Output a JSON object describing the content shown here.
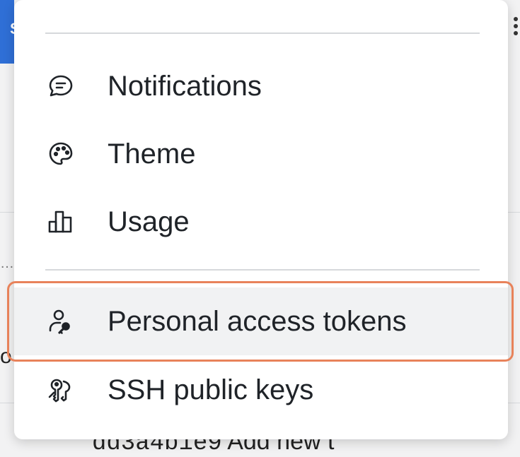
{
  "background": {
    "left_letter": "S",
    "ellipsis": "…",
    "partial_letter": "o",
    "bottom_code": "dd3a4b1e9",
    "bottom_text": "Add new t"
  },
  "menu": {
    "items": [
      {
        "label": "Notifications",
        "icon": "notification-bubble-icon",
        "active": false
      },
      {
        "label": "Theme",
        "icon": "palette-icon",
        "active": false
      },
      {
        "label": "Usage",
        "icon": "usage-chart-icon",
        "active": false
      },
      {
        "label": "Personal access tokens",
        "icon": "user-key-icon",
        "active": true
      },
      {
        "label": "SSH public keys",
        "icon": "keys-icon",
        "active": false
      }
    ]
  },
  "colors": {
    "highlight": "#e8825a",
    "accent_blue": "#2f6fd6",
    "active_bg": "#f1f2f3"
  }
}
